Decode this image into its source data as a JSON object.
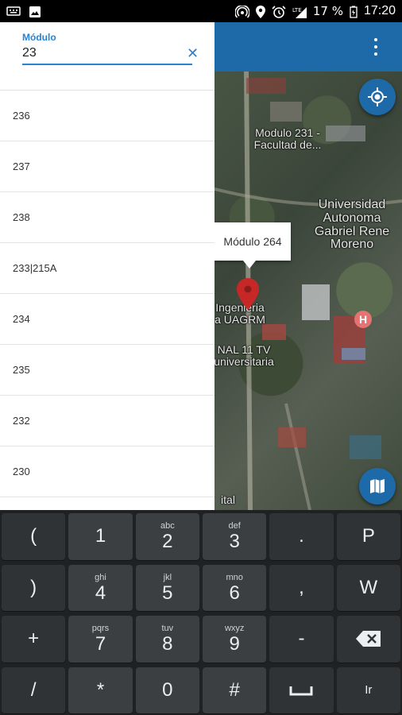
{
  "status_bar": {
    "battery": "17 %",
    "time": "17:20",
    "icons": [
      "keyboard-icon",
      "image-icon",
      "hotspot-icon",
      "location-icon",
      "alarm-icon",
      "data-roaming-icon",
      "signal-icon",
      "battery-icon"
    ]
  },
  "search": {
    "label": "Módulo",
    "value": "23",
    "clear_icon": "close-icon"
  },
  "results": [
    "236",
    "237",
    "238",
    "233|215A",
    "234",
    "235",
    "232",
    "230"
  ],
  "map": {
    "info_window": "Módulo 264",
    "labels": {
      "modulo_231": "Modulo 231 -\nFacultad de...",
      "university": "Universidad\nAutonoma\nGabriel Rene\nMoreno",
      "ingenieria": "Ingenieria\na UAGRM",
      "canal": "NAL 11 TV\nuniversitaria",
      "bottom": "ital"
    },
    "hospital_badge": "H",
    "accent_color": "#1e6aa8",
    "marker_color": "#c62828"
  },
  "keyboard": {
    "keys": [
      {
        "main": "(",
        "sub": ""
      },
      {
        "main": "1",
        "sub": ""
      },
      {
        "main": "2",
        "sub": "abc"
      },
      {
        "main": "3",
        "sub": "def"
      },
      {
        "main": ".",
        "sub": ""
      },
      {
        "main": "P",
        "sub": ""
      },
      {
        "main": ")",
        "sub": ""
      },
      {
        "main": "4",
        "sub": "ghi"
      },
      {
        "main": "5",
        "sub": "jkl"
      },
      {
        "main": "6",
        "sub": "mno"
      },
      {
        "main": ",",
        "sub": ""
      },
      {
        "main": "W",
        "sub": ""
      },
      {
        "main": "+",
        "sub": ""
      },
      {
        "main": "7",
        "sub": "pqrs"
      },
      {
        "main": "8",
        "sub": "tuv"
      },
      {
        "main": "9",
        "sub": "wxyz"
      },
      {
        "main": "-",
        "sub": ""
      },
      {
        "main": "",
        "sub": "",
        "icon": "backspace-icon"
      },
      {
        "main": "/",
        "sub": ""
      },
      {
        "main": "*",
        "sub": ""
      },
      {
        "main": "0",
        "sub": ""
      },
      {
        "main": "#",
        "sub": ""
      },
      {
        "main": "",
        "sub": "",
        "icon": "space-icon"
      },
      {
        "main": "Ir",
        "sub": ""
      }
    ]
  }
}
